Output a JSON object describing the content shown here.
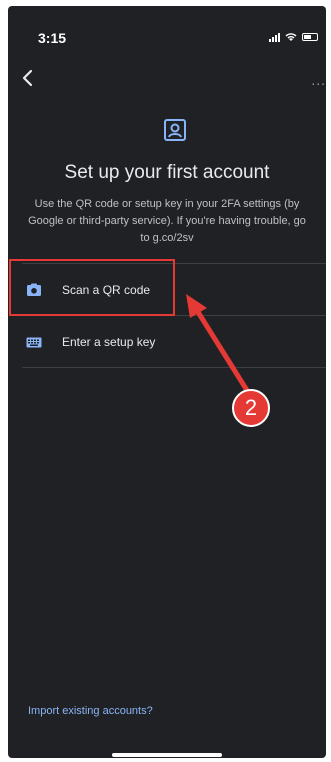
{
  "status_bar": {
    "time": "3:15"
  },
  "header": {
    "more_label": "..."
  },
  "setup": {
    "title": "Set up your first account",
    "description": "Use the QR code or setup key in your 2FA settings (by Google or third-party service). If you're having trouble, go to g.co/2sv"
  },
  "options": [
    {
      "label": "Scan a QR code",
      "icon": "camera-icon"
    },
    {
      "label": "Enter a setup key",
      "icon": "keyboard-icon"
    }
  ],
  "footer": {
    "import_label": "Import existing accounts?"
  },
  "annotation": {
    "step": "2",
    "color": "#e53935"
  },
  "colors": {
    "background": "#202124",
    "text": "#e8eaed",
    "link": "#8ab4f8",
    "icon_accent": "#8ab4f8"
  }
}
